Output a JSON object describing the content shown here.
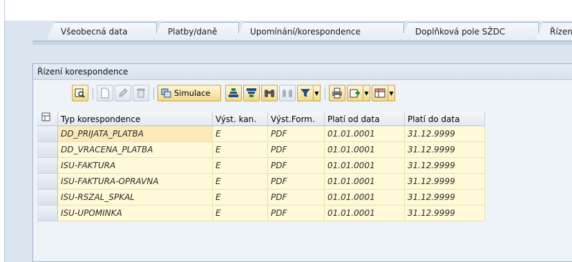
{
  "tabs": [
    {
      "label": "Všeobecná data"
    },
    {
      "label": "Platby/daně"
    },
    {
      "label": "Upomínání/korespondence"
    },
    {
      "label": "Doplňková pole SŽDC"
    },
    {
      "label": "Řízení"
    }
  ],
  "group": {
    "title": "Řízení korespondence"
  },
  "toolbar": {
    "simulace_label": "Simulace"
  },
  "grid": {
    "columns": [
      "Typ korespondence",
      "Výst. kan.",
      "Výst.Form.",
      "Platí od data",
      "Platí do data"
    ],
    "rows": [
      [
        "DD_PRIJATA_PLATBA",
        "E",
        "PDF",
        "01.01.0001",
        "31.12.9999"
      ],
      [
        "DD_VRACENA_PLATBA",
        "E",
        "PDF",
        "01.01.0001",
        "31.12.9999"
      ],
      [
        "ISU-FAKTURA",
        "E",
        "PDF",
        "01.01.0001",
        "31.12.9999"
      ],
      [
        "ISU-FAKTURA-OPRAVNA",
        "E",
        "PDF",
        "01.01.0001",
        "31.12.9999"
      ],
      [
        "ISU-RSZAL_SPKAL",
        "E",
        "PDF",
        "01.01.0001",
        "31.12.9999"
      ],
      [
        "ISU-UPOMINKA",
        "E",
        "PDF",
        "01.01.0001",
        "31.12.9999"
      ]
    ]
  },
  "colors": {
    "accent": "#c8a24a",
    "cell_bg": "#fff9d8",
    "frame": "#dbe5f0"
  }
}
